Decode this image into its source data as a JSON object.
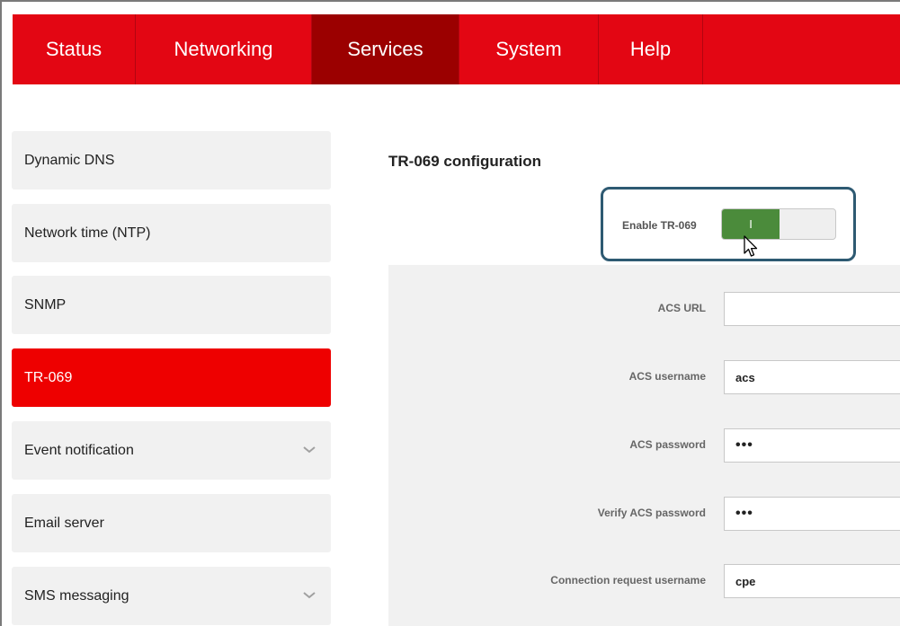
{
  "topnav": {
    "tabs": [
      {
        "label": "Status"
      },
      {
        "label": "Networking"
      },
      {
        "label": "Services"
      },
      {
        "label": "System"
      },
      {
        "label": "Help"
      }
    ],
    "active": "Services"
  },
  "sidebar": {
    "items": [
      {
        "label": "Dynamic DNS"
      },
      {
        "label": "Network time (NTP)"
      },
      {
        "label": "SNMP"
      },
      {
        "label": "TR-069"
      },
      {
        "label": "Event notification"
      },
      {
        "label": "Email server"
      },
      {
        "label": "SMS messaging"
      }
    ],
    "active": "TR-069"
  },
  "main": {
    "title": "TR-069 configuration",
    "enable_label": "Enable TR-069",
    "toggle_on_text": "I",
    "fields": [
      {
        "label": "ACS URL",
        "value": ""
      },
      {
        "label": "ACS username",
        "value": "acs"
      },
      {
        "label": "ACS password",
        "value": "•••"
      },
      {
        "label": "Verify ACS password",
        "value": "•••"
      },
      {
        "label": "Connection request username",
        "value": "cpe"
      }
    ]
  },
  "colors": {
    "brand_red": "#e30613",
    "active_tab": "#9b0000",
    "toggle_green": "#4b8b3b",
    "highlight_border": "#2e5a72"
  }
}
